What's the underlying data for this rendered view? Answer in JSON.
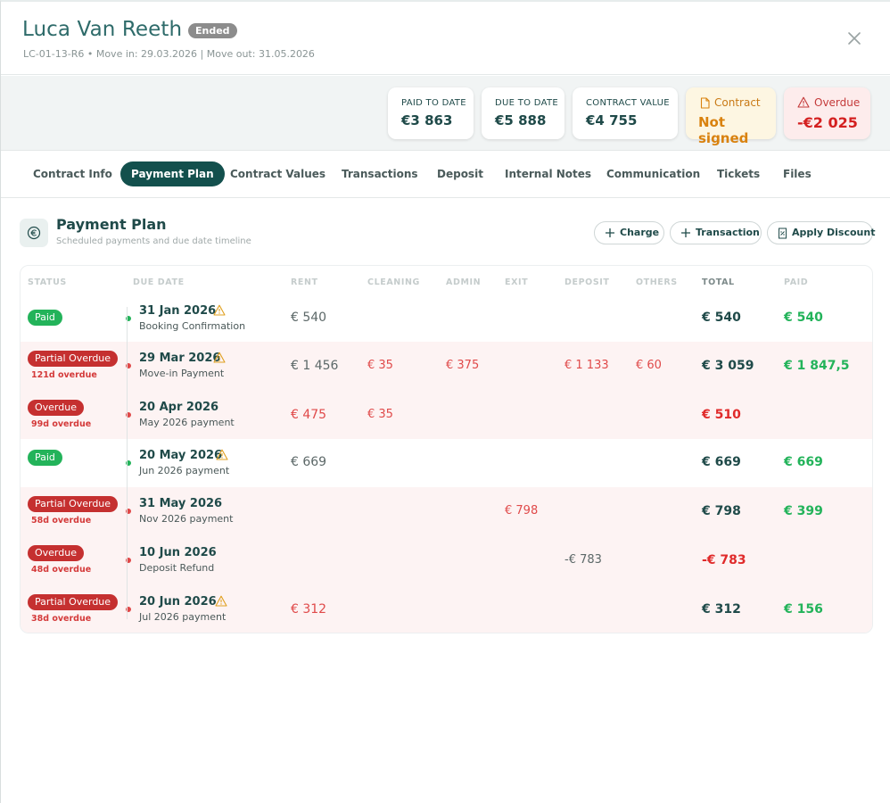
{
  "header": {
    "name": "Luca Van Reeth",
    "status_badge": "Ended",
    "subline": "LC-01-13-R6 • Move in: 29.03.2026 | Move out: 31.05.2026"
  },
  "summary": {
    "paid_to_date": {
      "label": "PAID TO DATE",
      "value": "€3 863"
    },
    "due_to_date": {
      "label": "DUE TO DATE",
      "value": "€5 888"
    },
    "contract_value": {
      "label": "CONTRACT VALUE",
      "value": "€4 755"
    },
    "contract": {
      "label": "Contract",
      "value": "Not signed"
    },
    "overdue": {
      "label": "Overdue",
      "value": "-€2 025"
    }
  },
  "tabs": [
    "Contract Info",
    "Payment Plan",
    "Contract Values",
    "Transactions",
    "Deposit",
    "Internal Notes",
    "Communication",
    "Tickets",
    "Files"
  ],
  "active_tab": "Payment Plan",
  "section": {
    "title": "Payment Plan",
    "subtitle": "Scheduled payments and due date timeline",
    "actions": {
      "charge": "Charge",
      "transaction": "Transaction",
      "discount": "Apply Discount"
    }
  },
  "table": {
    "columns": {
      "status": "STATUS",
      "due_date": "DUE DATE",
      "rent": "RENT",
      "cleaning": "CLEANING",
      "admin": "ADMIN",
      "exit": "EXIT",
      "deposit": "DEPOSIT",
      "others": "OTHERS",
      "total": "TOTAL",
      "paid": "PAID"
    },
    "rows": [
      {
        "status": "Paid",
        "days": "",
        "date": "31 Jan 2026",
        "desc": "Booking Confirmation",
        "rent": "€ 540",
        "cleaning": "",
        "admin": "",
        "exit": "",
        "deposit": "",
        "others": "",
        "total": "€ 540",
        "paid": "€ 540"
      },
      {
        "status": "Partial Overdue",
        "days": "121d overdue",
        "date": "29 Mar 2026",
        "desc": "Move-in Payment",
        "rent": "€ 1 456",
        "cleaning": "€ 35",
        "admin": "€ 375",
        "exit": "",
        "deposit": "€ 1 133",
        "others": "€ 60",
        "total": "€ 3 059",
        "paid": "€ 1 847,5"
      },
      {
        "status": "Overdue",
        "days": "99d overdue",
        "date": "20 Apr 2026",
        "desc": "May 2026 payment",
        "rent": "€ 475",
        "cleaning": "€ 35",
        "admin": "",
        "exit": "",
        "deposit": "",
        "others": "",
        "total": "€ 510",
        "paid": ""
      },
      {
        "status": "Paid",
        "days": "",
        "date": "20 May 2026",
        "desc": "Jun 2026 payment",
        "rent": "€ 669",
        "cleaning": "",
        "admin": "",
        "exit": "",
        "deposit": "",
        "others": "",
        "total": "€ 669",
        "paid": "€ 669"
      },
      {
        "status": "Partial Overdue",
        "days": "58d overdue",
        "date": "31 May 2026",
        "desc": "Nov 2026 payment",
        "rent": "",
        "cleaning": "",
        "admin": "",
        "exit": "€ 798",
        "deposit": "",
        "others": "",
        "total": "€ 798",
        "paid": "€ 399"
      },
      {
        "status": "Overdue",
        "days": "48d overdue",
        "date": "10 Jun 2026",
        "desc": "Deposit Refund",
        "rent": "",
        "cleaning": "",
        "admin": "",
        "exit": "",
        "deposit": "-€ 783",
        "others": "",
        "total": "-€ 783",
        "paid": ""
      },
      {
        "status": "Partial Overdue",
        "days": "38d overdue",
        "date": "20 Jun 2026",
        "desc": "Jul 2026 payment",
        "rent": "€ 312",
        "cleaning": "",
        "admin": "",
        "exit": "",
        "deposit": "",
        "others": "",
        "total": "€ 312",
        "paid": "€ 156"
      }
    ]
  },
  "colors": {
    "brand": "#13504d",
    "paid": "#23b35a",
    "overdue": "#c53030",
    "warning": "#e0a020"
  }
}
